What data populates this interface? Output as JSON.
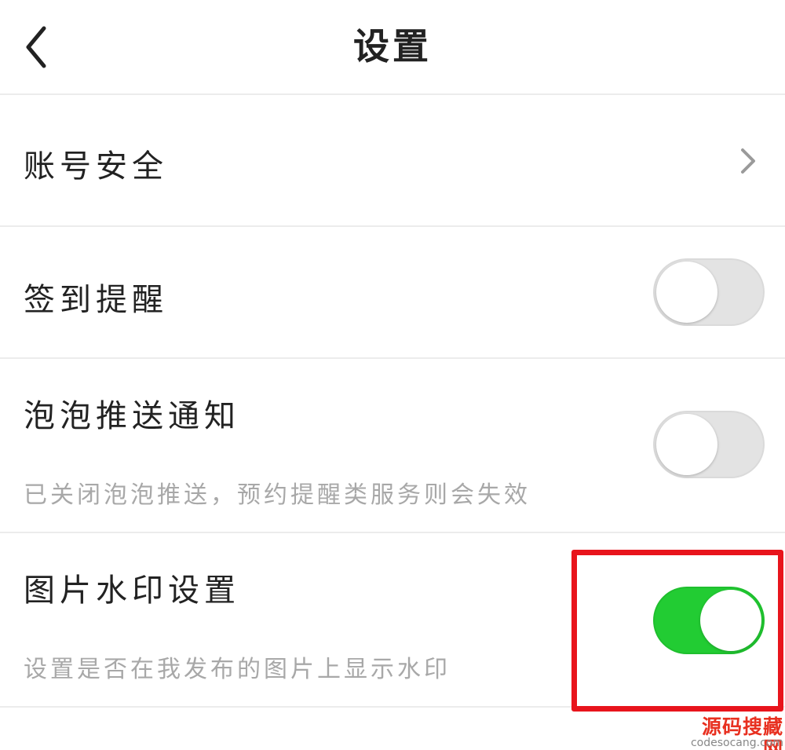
{
  "header": {
    "title": "设置",
    "back_icon": "chevron-left-icon"
  },
  "settings": {
    "account_security": {
      "label": "账号安全",
      "icon": "chevron-right-icon"
    },
    "checkin_reminder": {
      "label": "签到提醒",
      "enabled": false
    },
    "bubble_push": {
      "label": "泡泡推送通知",
      "description": "已关闭泡泡推送，预约提醒类服务则会失效",
      "enabled": false
    },
    "image_watermark": {
      "label": "图片水印设置",
      "description": "设置是否在我发布的图片上显示水印",
      "enabled": true
    }
  },
  "watermark": {
    "text": "源码搜藏网",
    "domain": "codesocang.com"
  },
  "colors": {
    "toggle_on": "#22cc33",
    "toggle_off": "#e3e3e3",
    "highlight_border": "#e8141c",
    "text_primary": "#222222",
    "text_secondary": "#a8a8a8"
  }
}
